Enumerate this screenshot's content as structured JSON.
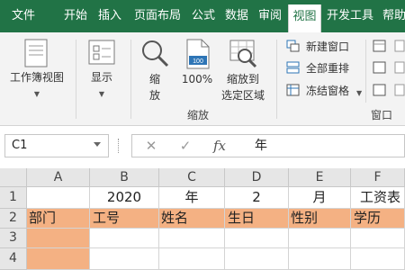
{
  "tabs": [
    {
      "label": "文件"
    },
    {
      "label": "开始"
    },
    {
      "label": "插入"
    },
    {
      "label": "页面布局"
    },
    {
      "label": "公式"
    },
    {
      "label": "数据"
    },
    {
      "label": "审阅"
    },
    {
      "label": "视图"
    },
    {
      "label": "开发工具"
    },
    {
      "label": "帮助"
    }
  ],
  "active_tab": "视图",
  "ribbon": {
    "workbook_views_label": "工作簿视图",
    "show_label": "显示",
    "zoom_label_1": "缩",
    "zoom_label_2": "放",
    "zoom100_label": "100%",
    "zoom_selection_label_1": "缩放到",
    "zoom_selection_label_2": "选定区域",
    "zoom_group_label": "缩放",
    "new_window_label": "新建窗口",
    "arrange_all_label": "全部重排",
    "freeze_panes_label": "冻结窗格",
    "window_group_label": "窗口"
  },
  "formula_bar": {
    "name_box": "C1",
    "cancel_icon": "✕",
    "enter_icon": "✓",
    "fx_label": "fx",
    "formula_value": "年"
  },
  "columns": [
    "A",
    "B",
    "C",
    "D",
    "E",
    "F"
  ],
  "rows": [
    "1",
    "2",
    "3",
    "4"
  ],
  "row1": [
    "",
    "2020",
    "年",
    "2",
    "月",
    "工资表"
  ],
  "row2": [
    "部门",
    "工号",
    "姓名",
    "生日",
    "性别",
    "学历"
  ],
  "colors": {
    "ribbon_green": "#217346",
    "header_fill": "#f4b183"
  }
}
